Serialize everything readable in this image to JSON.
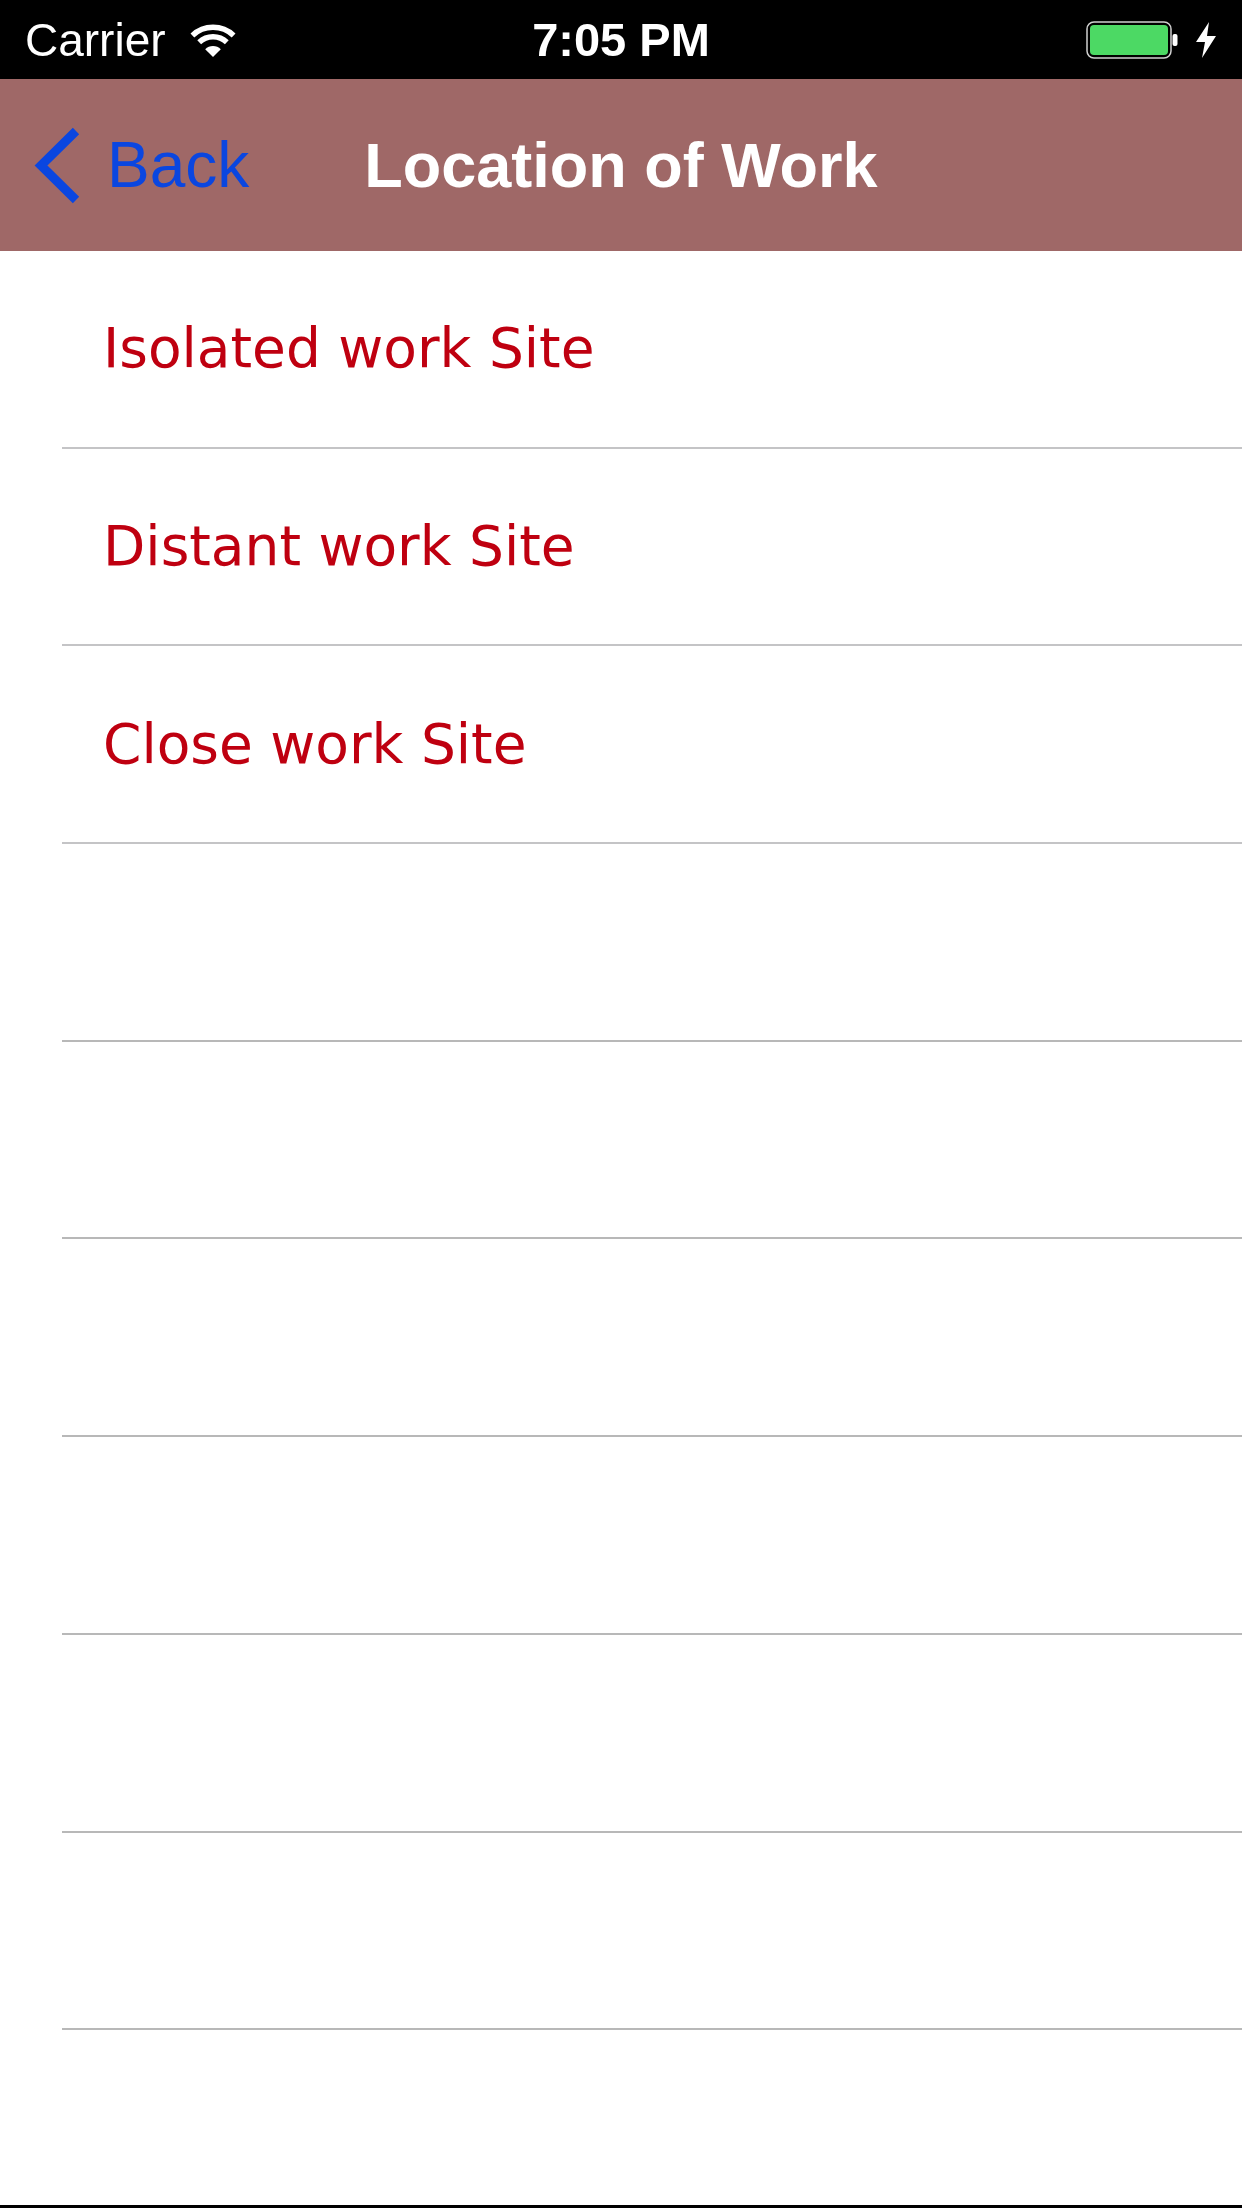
{
  "status_bar": {
    "carrier": "Carrier",
    "time": "7:05 PM"
  },
  "nav_bar": {
    "back": "Back",
    "title": "Location of Work"
  },
  "list": {
    "items": [
      {
        "label": "Isolated work Site"
      },
      {
        "label": "Distant work Site"
      },
      {
        "label": "Close work Site"
      }
    ]
  }
}
